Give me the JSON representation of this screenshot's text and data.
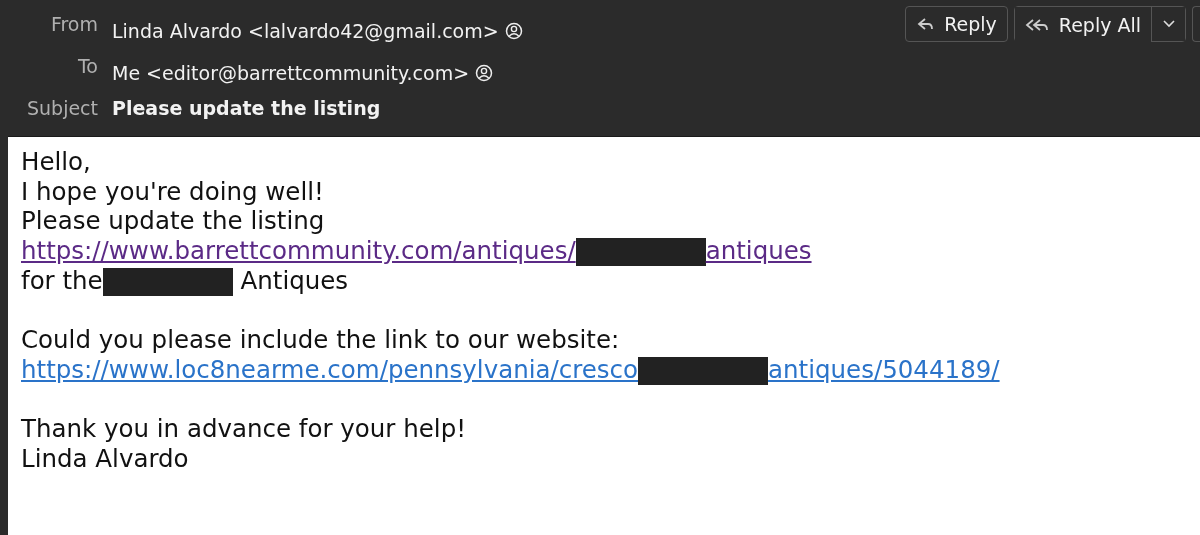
{
  "header": {
    "fields": [
      {
        "label": "From",
        "value": "Linda Alvardo <lalvardo42@gmail.com>",
        "contact_icon": true
      },
      {
        "label": "To",
        "value": "Me <editor@barrettcommunity.com>",
        "contact_icon": true
      },
      {
        "label": "Subject",
        "value": "Please update the listing",
        "contact_icon": false
      }
    ],
    "buttons": [
      {
        "kind": "reply",
        "label": "Reply"
      },
      {
        "kind": "reply-all",
        "label": "Reply All",
        "dropdown": true
      },
      {
        "kind": "partial"
      }
    ]
  },
  "body": {
    "lines": [
      {
        "kind": "line",
        "segments": [
          {
            "kind": "text",
            "text": "Hello,"
          }
        ]
      },
      {
        "kind": "line",
        "segments": [
          {
            "kind": "text",
            "text": "I hope you're doing well!"
          }
        ]
      },
      {
        "kind": "line",
        "segments": [
          {
            "kind": "text",
            "text": "Please update the listing"
          }
        ]
      },
      {
        "kind": "line",
        "segments": [
          {
            "kind": "link",
            "text": "https://www.barrettcommunity.com/antiques/",
            "visited": true
          },
          {
            "kind": "redaction"
          },
          {
            "kind": "link",
            "text": "antiques",
            "visited": true
          }
        ]
      },
      {
        "kind": "line",
        "segments": [
          {
            "kind": "text",
            "text": "for the"
          },
          {
            "kind": "redaction"
          },
          {
            "kind": "text",
            "text": "Antiques"
          }
        ]
      },
      {
        "kind": "blank"
      },
      {
        "kind": "line",
        "segments": [
          {
            "kind": "text",
            "text": "Could you please include the link to our website:"
          }
        ]
      },
      {
        "kind": "line",
        "segments": [
          {
            "kind": "link",
            "text": "https://www.loc8nearme.com/pennsylvania/cresco",
            "visited": false
          },
          {
            "kind": "redaction"
          },
          {
            "kind": "link",
            "text": "antiques/5044189/",
            "visited": false
          }
        ]
      },
      {
        "kind": "blank"
      },
      {
        "kind": "line",
        "segments": [
          {
            "kind": "text",
            "text": "Thank you in advance for your help!"
          }
        ]
      },
      {
        "kind": "line",
        "segments": [
          {
            "kind": "text",
            "text": "Linda Alvardo"
          }
        ]
      }
    ]
  }
}
